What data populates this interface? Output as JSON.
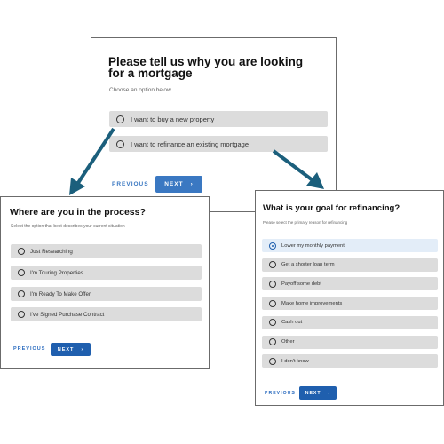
{
  "main": {
    "title": "Please tell us why you are looking for a mortgage",
    "subtitle": "Choose an option below",
    "options": [
      "I want to buy a new property",
      "I want to refinance an existing mortgage"
    ],
    "previous_label": "PREVIOUS",
    "next_label": "NEXT"
  },
  "purchase": {
    "title": "Where are you in the process?",
    "subtitle": "Select the option that best describes your current situation",
    "options": [
      "Just Researching",
      "I'm Touring Properties",
      "I'm Ready To Make Offer",
      "I've Signed Purchase Contract"
    ],
    "previous_label": "PREVIOUS",
    "next_label": "NEXT"
  },
  "refinance": {
    "title": "What is your goal for refinancing?",
    "subtitle": "Please select the primary reason for refinancing",
    "options": [
      "Lower my monthly payment",
      "Get a shorter loan term",
      "Payoff some debt",
      "Make home improvements",
      "Cash out",
      "Other",
      "I don't know"
    ],
    "selected_option": "Lower my monthly payment",
    "previous_label": "PREVIOUS",
    "next_label": "NEXT"
  },
  "colors": {
    "accent": "#1f5fae",
    "arrow": "#1b5f7c",
    "option_bg": "#dcdcdc",
    "selected_bg": "#e3edf8"
  },
  "icons": {
    "radio": "radio-circle",
    "next": "chevron-right-icon",
    "connector": "arrow-icon"
  }
}
